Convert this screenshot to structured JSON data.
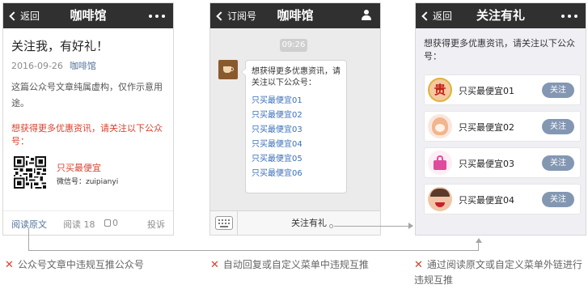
{
  "phone1": {
    "nav": {
      "back": "返回",
      "title": "咖啡馆"
    },
    "article": {
      "title": "关注我，有好礼！",
      "date": "2016-09-26",
      "account": "咖啡馆",
      "body": "这篇公众号文章纯属虚构，仅作示意用途。",
      "promo": "想获得更多优惠资讯，请关注以下公众号：",
      "qr_name": "只买最便宜",
      "qr_id": "微信号：zuipianyi"
    },
    "footer": {
      "read_original": "阅读原文",
      "reads": "阅读 18",
      "likes": "0",
      "report": "投诉"
    }
  },
  "phone2": {
    "nav": {
      "back": "订阅号",
      "title": "咖啡馆"
    },
    "time": "09:26",
    "message": "想获得更多优惠资讯，请关注以下公众号：",
    "links": [
      "只买最便宜01",
      "只买最便宜02",
      "只买最便宜03",
      "只买最便宜04",
      "只买最便宜05",
      "只买最便宜06"
    ],
    "menu": "关注有礼"
  },
  "phone3": {
    "nav": {
      "back": "返回",
      "title": "关注有礼"
    },
    "intro": "想获得更多优惠资讯，请关注以下公众号：",
    "avatar1_char": "贵",
    "accounts": [
      {
        "name": "只买最便宜01",
        "button": "关注"
      },
      {
        "name": "只买最便宜02",
        "button": "关注"
      },
      {
        "name": "只买最便宜03",
        "button": "关注"
      },
      {
        "name": "只买最便宜04",
        "button": "关注"
      }
    ]
  },
  "captions": [
    "公众号文章中违规互推公众号",
    "自动回复或自定义菜单中违规互推",
    "通过阅读原文或自定义菜单外链进行违规互推"
  ],
  "icons": {
    "cross": "cross-icon",
    "back": "chevron-left-icon",
    "more": "more-dots-icon",
    "profile": "person-icon",
    "keyboard": "keyboard-icon",
    "qr": "qr-code-icon",
    "like": "thumb-up-icon"
  },
  "colors": {
    "nav_bg": "#303030",
    "link_blue": "#3b6fb6",
    "promo_red": "#d9412d",
    "follow_btn": "#8397b2"
  }
}
